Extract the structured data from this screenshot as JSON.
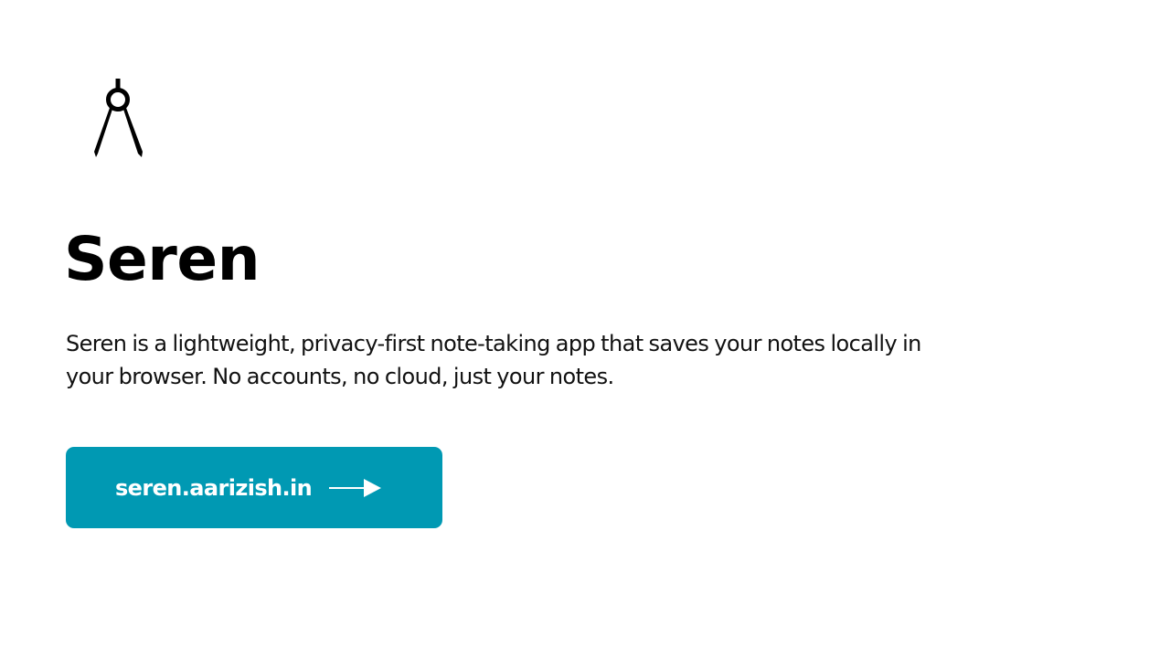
{
  "app": {
    "title": "Seren",
    "description": "Seren is a lightweight, privacy-first note-taking app that saves your notes locally in your browser. No accounts, no cloud, just your notes.",
    "logo_icon": "drafting-compass-icon"
  },
  "cta": {
    "label": "seren.aarizish.in",
    "arrow_icon": "arrow-right-icon",
    "background_color": "#0099b3",
    "text_color": "#ffffff"
  }
}
